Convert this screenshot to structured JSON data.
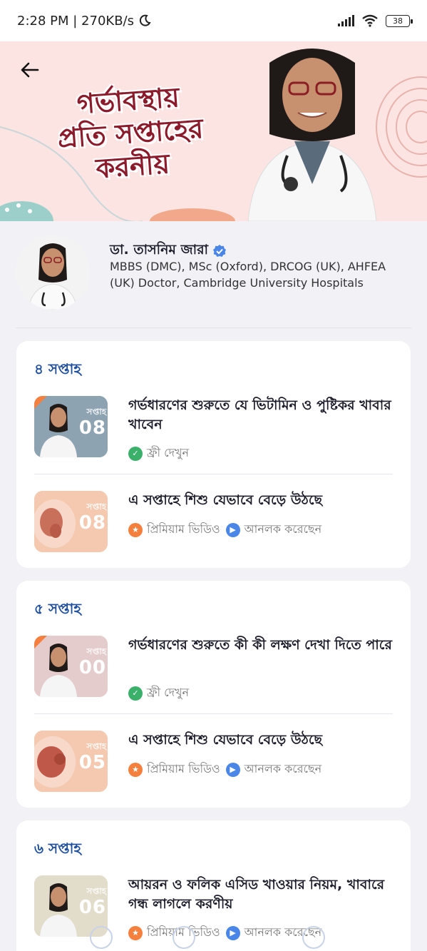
{
  "status_bar": {
    "time": "2:28 PM | 270KB/s",
    "battery": "38"
  },
  "banner": {
    "title_lines": [
      "গর্ভাবস্থায়",
      "প্রতি সপ্তাহের",
      "করনীয়"
    ]
  },
  "doctor": {
    "name": "ডা. তাসনিম জারা",
    "credentials": "MBBS (DMC), MSc (Oxford), DRCOG (UK), AHFEA (UK) Doctor, Cambridge University Hospitals"
  },
  "weeks": [
    {
      "title": "৪ সপ্তাহ",
      "videos": [
        {
          "title": "গর্ভধারণের শুরুতে যে ভিটামিন ও পুষ্টিকর খাবার খাবেন",
          "thumb_week": "সপ্তাহ",
          "thumb_num": "08",
          "tag": "ফ্রী দেখুন",
          "tag2": ""
        },
        {
          "title": "এ সপ্তাহে শিশু যেভাবে বেড়ে উঠছে",
          "thumb_week": "সপ্তাহ",
          "thumb_num": "08",
          "tag": "প্রিমিয়াম ভিডিও",
          "tag2": "আনলক করেছেন"
        }
      ]
    },
    {
      "title": "৫ সপ্তাহ",
      "videos": [
        {
          "title": "গর্ভধারণের শুরুতে কী কী লক্ষণ দেখা দিতে পারে",
          "thumb_week": "সপ্তাহ",
          "thumb_num": "00",
          "tag": "ফ্রী দেখুন",
          "tag2": ""
        },
        {
          "title": "এ সপ্তাহে শিশু যেভাবে বেড়ে উঠছে",
          "thumb_week": "সপ্তাহ",
          "thumb_num": "05",
          "tag": "প্রিমিয়াম ভিডিও",
          "tag2": "আনলক করেছেন"
        }
      ]
    },
    {
      "title": "৬ সপ্তাহ",
      "videos": [
        {
          "title": "আয়রন ও ফলিক এসিড খাওয়ার নিয়ম, খাবারে গন্ধ লাগলে করণীয়",
          "thumb_week": "সপ্তাহ",
          "thumb_num": "06",
          "tag": "প্রিমিয়াম ভিডিও",
          "tag2": "আনলক করেছেন"
        }
      ]
    }
  ],
  "colors": {
    "accent_blue": "#1f4fa0",
    "free_green": "#3ab06a",
    "premium_orange": "#f5803e",
    "play_blue": "#4a85e8",
    "banner_pink": "#fbe4e2"
  }
}
